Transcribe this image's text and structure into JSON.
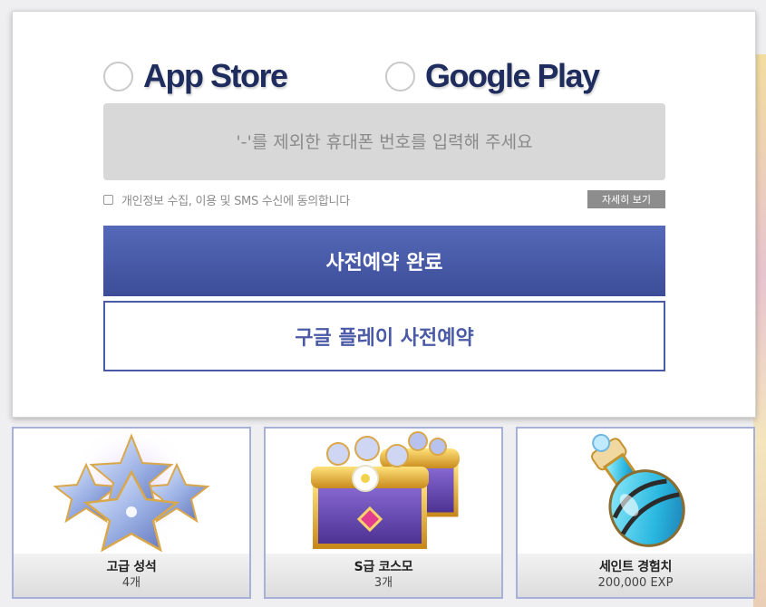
{
  "stores": {
    "app_store": "App Store",
    "google_play": "Google Play"
  },
  "phone": {
    "placeholder": "'-'를 제외한 휴대폰 번호를 입력해 주세요",
    "value": ""
  },
  "consent": {
    "label": "개인정보 수집, 이용 및 SMS 수신에 동의합니다",
    "detail_button": "자세히 보기"
  },
  "buttons": {
    "submit": "사전예약 완료",
    "google_preregister": "구글 플레이 사전예약"
  },
  "rewards": [
    {
      "name": "고급 성석",
      "qty": "4개",
      "icon": "star-crystal-icon"
    },
    {
      "name": "S급 코스모",
      "qty": "3개",
      "icon": "treasure-chest-icon"
    },
    {
      "name": "세인트 경험치",
      "qty": "200,000 EXP",
      "icon": "potion-bottle-icon"
    }
  ],
  "colors": {
    "brand_navy": "#1e2c5e",
    "button_blue": "#4a5aa6",
    "card_border": "#a6b0d8"
  }
}
